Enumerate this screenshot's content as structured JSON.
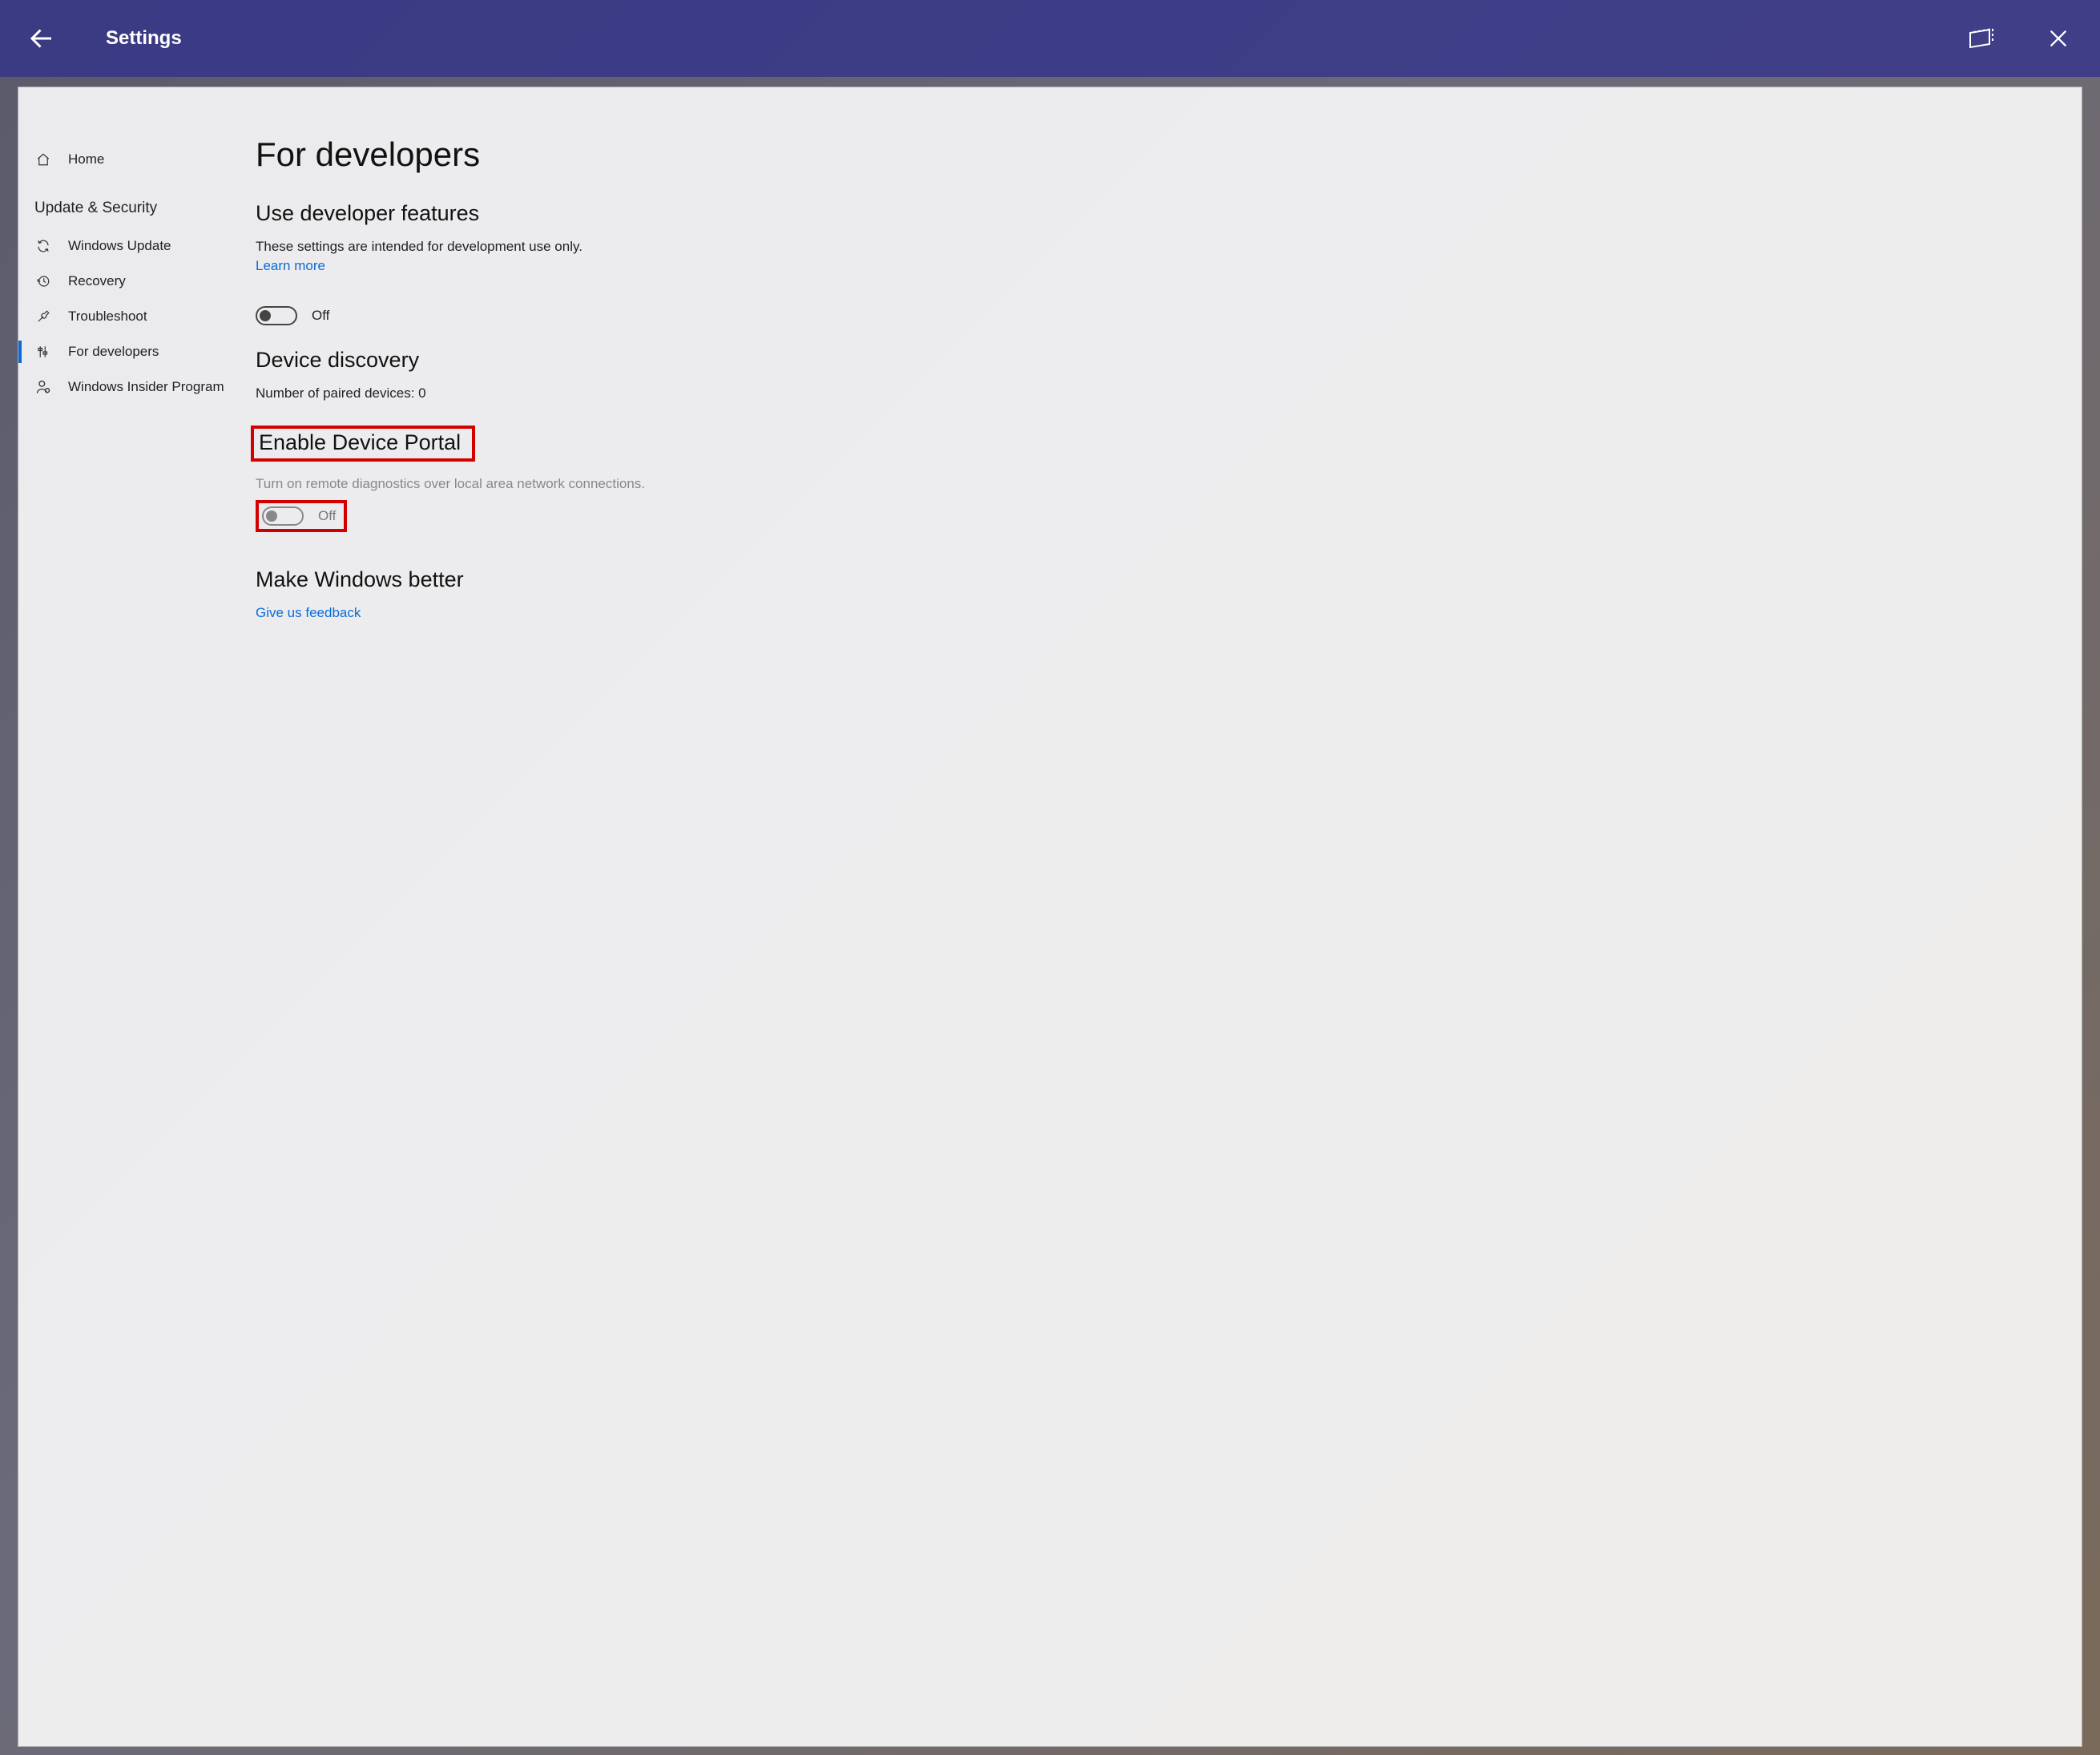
{
  "header": {
    "title": "Settings"
  },
  "sidebar": {
    "home_label": "Home",
    "section_label": "Update & Security",
    "items": [
      {
        "label": "Windows Update"
      },
      {
        "label": "Recovery"
      },
      {
        "label": "Troubleshoot"
      },
      {
        "label": "For developers"
      },
      {
        "label": "Windows Insider Program"
      }
    ]
  },
  "content": {
    "page_title": "For developers",
    "section1": {
      "heading": "Use developer features",
      "desc": "These settings are intended for development use only.",
      "learn_more": "Learn more",
      "toggle_state": "Off"
    },
    "section2": {
      "heading": "Device discovery",
      "paired_label": "Number of paired devices: 0"
    },
    "section3": {
      "heading": "Enable Device Portal",
      "desc": "Turn on remote diagnostics over local area network connections.",
      "toggle_state": "Off"
    },
    "section4": {
      "heading": "Make Windows better",
      "feedback_link": "Give us feedback"
    }
  },
  "annotation_color": "#d40000"
}
